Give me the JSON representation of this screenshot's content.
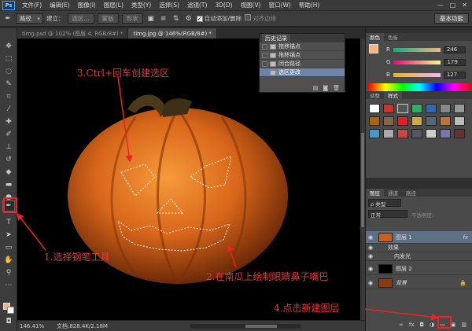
{
  "menubar": {
    "logo": "Ps",
    "items": [
      "文件(F)",
      "编辑(E)",
      "图像(I)",
      "图层(L)",
      "类型(Y)",
      "选择(S)",
      "滤镜(T)",
      "3D(D)",
      "视图(V)",
      "窗口(W)",
      "帮助(H)"
    ],
    "controls": [
      "—",
      "□",
      "✕"
    ]
  },
  "options": {
    "mode": "路径",
    "make_label": "建立：",
    "selection_btn": "选区...",
    "mask_btn": "蒙版",
    "shape_btn": "形状",
    "auto_add_label": "自动添加/删除",
    "align_edges_label": "对齐边缘",
    "workspace": "基本功能"
  },
  "tabs": [
    "timg.psd @ 102% (图层 4, RGB/8#) *",
    "timg.jpg @ 146%(RGB/8#) *"
  ],
  "status": {
    "zoom": "146.41%",
    "doc": "文档:828.4K/2.18M"
  },
  "history": {
    "title": "历史记录",
    "rows": [
      "拖移锚点",
      "拖移锚点",
      "闭合路径",
      "选区更改"
    ],
    "selected_index": 3
  },
  "color_panel": {
    "tabs": [
      "颜色",
      "色板"
    ],
    "channels": [
      {
        "name": "R",
        "value": "246"
      },
      {
        "name": "G",
        "value": "179"
      },
      {
        "name": "B",
        "value": "127"
      }
    ],
    "foreground": "#f6b37f"
  },
  "styles_panel": {
    "tabs": [
      "调整",
      "样式"
    ]
  },
  "layers_panel": {
    "tabs": [
      "图层",
      "通道",
      "路径"
    ],
    "kind_filter": "ρ 类型",
    "blend_mode": "正常",
    "opacity_label": "不透明度:",
    "layers": [
      {
        "name": "图层 1",
        "fx": "fx"
      },
      {
        "name": "效果"
      },
      {
        "name": "内发光"
      },
      {
        "name": "图层 2"
      },
      {
        "name": "背景"
      }
    ]
  },
  "annotations": {
    "step1": "1.选择钢笔工具",
    "step2": "2.在南瓜上绘制眼睛鼻子嘴巴",
    "step3": "3.Ctrl+回车创建选区",
    "step4": "4.点击新建图层"
  }
}
